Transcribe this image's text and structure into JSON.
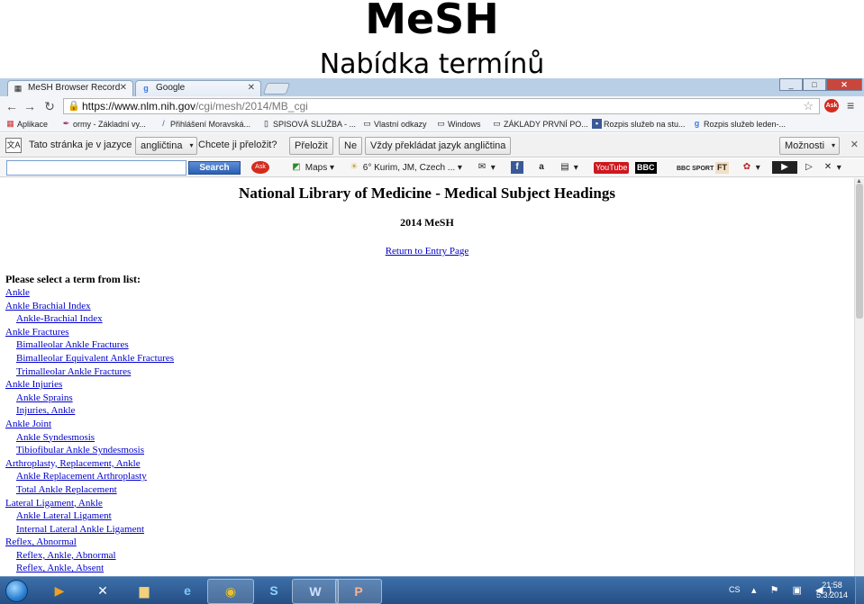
{
  "slide": {
    "title": "MeSH",
    "subtitle": "Nabídka termínů"
  },
  "browser": {
    "tabs": [
      {
        "label": "MeSH Browser Record",
        "active": true,
        "icon": "mesh-page-icon"
      },
      {
        "label": "Google",
        "active": false,
        "icon": "google-icon"
      }
    ],
    "url_host": "https://www.nlm.nih.gov",
    "url_path": "/cgi/mesh/2014/MB_cgi",
    "bookmarks": [
      "Aplikace",
      "ormy - Základní vy...",
      "Přihlášení Moravská...",
      "SPISOVÁ SLUŽBA - ...",
      "Vlastní odkazy",
      "Windows",
      "ZÁKLADY PRVNÍ PO...",
      "Rozpis služeb na stu...",
      "Rozpis služeb leden-..."
    ],
    "translate": {
      "prefix": "Tato stránka je v jazyce",
      "language": "angličtina",
      "question": "Chcete ji přeložit?",
      "translate_btn": "Přeložit",
      "no_btn": "Ne",
      "always_btn": "Vždy překládat jazyk angličtina",
      "options_btn": "Možnosti"
    },
    "toolbar": {
      "search_label": "Search",
      "maps_label": "Maps",
      "weather_label": "6° Kurim, JM, Czech ...",
      "bbc_label": "BBC",
      "bbc_sport_label": "BBC SPORT",
      "ft_label": "FT",
      "youtube_label": "YouTube"
    }
  },
  "page": {
    "heading": "National Library of Medicine - Medical Subject Headings",
    "year": "2014 MeSH",
    "return_link": "Return to Entry Page",
    "prompt": "Please select a term from list:",
    "terms": [
      {
        "label": "Ankle",
        "level": 0
      },
      {
        "label": "Ankle Brachial Index",
        "level": 0
      },
      {
        "label": "Ankle-Brachial Index",
        "level": 1
      },
      {
        "label": "Ankle Fractures",
        "level": 0
      },
      {
        "label": "Bimalleolar Ankle Fractures",
        "level": 1
      },
      {
        "label": "Bimalleolar Equivalent Ankle Fractures",
        "level": 1
      },
      {
        "label": "Trimalleolar Ankle Fractures",
        "level": 1
      },
      {
        "label": "Ankle Injuries",
        "level": 0
      },
      {
        "label": "Ankle Sprains",
        "level": 1
      },
      {
        "label": "Injuries, Ankle",
        "level": 1
      },
      {
        "label": "Ankle Joint",
        "level": 0
      },
      {
        "label": "Ankle Syndesmosis",
        "level": 1
      },
      {
        "label": "Tibiofibular Ankle Syndesmosis",
        "level": 1
      },
      {
        "label": "Arthroplasty, Replacement, Ankle",
        "level": 0
      },
      {
        "label": "Ankle Replacement Arthroplasty",
        "level": 1
      },
      {
        "label": "Total Ankle Replacement",
        "level": 1
      },
      {
        "label": "Lateral Ligament, Ankle",
        "level": 0
      },
      {
        "label": "Ankle Lateral Ligament",
        "level": 1
      },
      {
        "label": "Internal Lateral Ankle Ligament",
        "level": 1
      },
      {
        "label": "Reflex, Abnormal",
        "level": 0
      },
      {
        "label": "Reflex, Ankle, Abnormal",
        "level": 1
      },
      {
        "label": "Reflex, Ankle, Absent",
        "level": 1
      }
    ]
  },
  "taskbar": {
    "language": "CS",
    "time": "21:58",
    "date": "5.3.2014"
  }
}
